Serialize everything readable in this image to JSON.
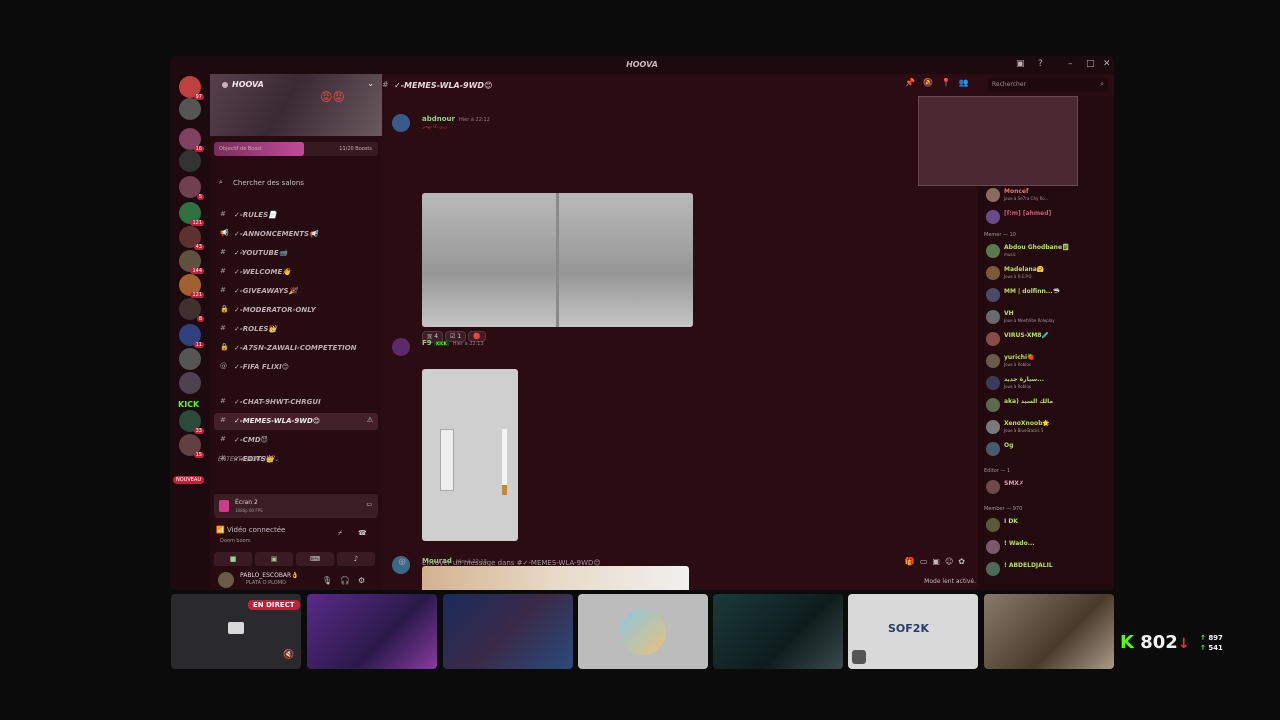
{
  "window": {
    "title": "HOOVA"
  },
  "rail": {
    "new_badge": "NOUVEAU",
    "kick_label": "KICK",
    "badges": [
      "97",
      "",
      "16",
      "",
      "5",
      "121",
      "43",
      "144",
      "121",
      "8",
      "11",
      "",
      "",
      "33",
      "15"
    ]
  },
  "server": {
    "name": "HOOVA",
    "boost_label": "Objectif de Boost",
    "boost_count": "11/20 Boosts",
    "boost_progress": 0.55,
    "search_channels": "Chercher des salons"
  },
  "channels": [
    {
      "icon": "#",
      "name": "✓-RULES📄"
    },
    {
      "icon": "📢",
      "name": "✓-ANNONCEMENTS📢"
    },
    {
      "icon": "#",
      "name": "✓-YOUTUBE📹"
    },
    {
      "icon": "#",
      "name": "✓-WELCOME👋"
    },
    {
      "icon": "#",
      "name": "✓-GIVEAWAYS🎉"
    },
    {
      "icon": "🔒",
      "name": "✓-MODERATOR-ONLY"
    },
    {
      "icon": "#",
      "name": "✓-ROLES👑"
    },
    {
      "icon": "🔒",
      "name": "✓-A7SN-ZAWALI-COMPETETION"
    },
    {
      "icon": "@",
      "name": "✓-FIFA FLIXI😊"
    }
  ],
  "category": "ENTERTAINEMENT",
  "channels2": [
    {
      "icon": "#",
      "name": "✓-CHAT-9HWT-CHRGUI",
      "active": false
    },
    {
      "icon": "#",
      "name": "✓-MEMES-WLA-9WD😊",
      "active": true
    },
    {
      "icon": "#",
      "name": "✓-CMD😈",
      "active": false
    },
    {
      "icon": "#",
      "name": "✓-EDITS👑",
      "active": false
    }
  ],
  "voice": {
    "screen_title": "Écran 2",
    "screen_sub": "1080p 60 FPS",
    "connected": "Vidéo connectée",
    "server": "Doom boom"
  },
  "user": {
    "name": "PABLO_ESCOBAR👌",
    "status": "PLATA O PLOMO"
  },
  "chat": {
    "channel": "✓-MEMES-WLA-9WD😊",
    "messages": [
      {
        "author": "abdnour",
        "time": "Hier à 22:12",
        "color": "#8fd07a",
        "extra": "ربي كا تهجر"
      },
      {
        "author": "F9",
        "time": "Hier à 22:13",
        "color": "#8fd07a",
        "tag": "KICK"
      },
      {
        "author": "Mourad",
        "time": "Hier à 22:13",
        "color": "#8fd07a"
      }
    ],
    "reactions": [
      "🇼 4",
      "☑ 1",
      "🔴"
    ],
    "placeholder": "Envoyer un message dans #✓-MEMES-WLA-9WD😊",
    "slow_mode": "Mode lent activé."
  },
  "search": {
    "placeholder": "Rechercher"
  },
  "members": {
    "top": [
      {
        "name": "Moncef",
        "status": "Joue à Se7ra City Ro...",
        "color": "#e07a6a",
        "badge": "STRA"
      },
      {
        "name": "[f:m]  [ahmed]",
        "status": "",
        "color": "#d05a7a"
      }
    ],
    "group_memer": "Memer — 10",
    "memer": [
      {
        "name": "Abdou Ghodbane🗒",
        "status": "music",
        "color": "#b8e05a"
      },
      {
        "name": "Madelana🤗",
        "status": "Joue à R.E.P.O.",
        "color": "#b8e05a"
      },
      {
        "name": "MM | dolfinn...🦈",
        "status": "",
        "color": "#b8e05a",
        "badge": "love"
      },
      {
        "name": "VH",
        "status": "Joue à MeetVibe Roleplay",
        "color": "#b8e05a"
      },
      {
        "name": "VIRUS-XM8🧪",
        "status": "",
        "color": "#b8e05a"
      },
      {
        "name": "yurichi🍓",
        "status": "Joue à Roblox",
        "color": "#b8e05a",
        "badge": "YB"
      },
      {
        "name": "سيارة جديد...",
        "status": "Joue à Roblox",
        "color": "#b8e05a",
        "badge": "luv"
      },
      {
        "name": "aka) مالك السيد",
        "status": "",
        "color": "#b8e05a"
      },
      {
        "name": "XenoXnoob🌟",
        "status": "Joue à BlueStacks 5",
        "color": "#b8e05a",
        "badge": "Xeno"
      },
      {
        "name": "Og",
        "status": "",
        "color": "#b8e05a"
      }
    ],
    "group_editor": "Editor — 1",
    "editor": [
      {
        "name": "SMX✗",
        "status": "",
        "color": "#e0a0b8"
      }
    ],
    "group_member": "Member — 970",
    "member": [
      {
        "name": "I DK",
        "status": "",
        "color": "#b8e05a"
      },
      {
        "name": "! Wado...",
        "status": "",
        "color": "#b8e05a",
        "badge": "Friends"
      },
      {
        "name": "! ABDELDJALIL",
        "status": "",
        "color": "#b8e05a"
      }
    ]
  },
  "stream_tiles": {
    "live_label": "EN DIRECT",
    "logo": "SOF2K"
  },
  "kick_stats": {
    "viewers": "802",
    "up": "897",
    "down": "541"
  },
  "colors": {
    "accent": "#c0213a",
    "kick": "#53fc18",
    "bg": "#2a0c12"
  }
}
